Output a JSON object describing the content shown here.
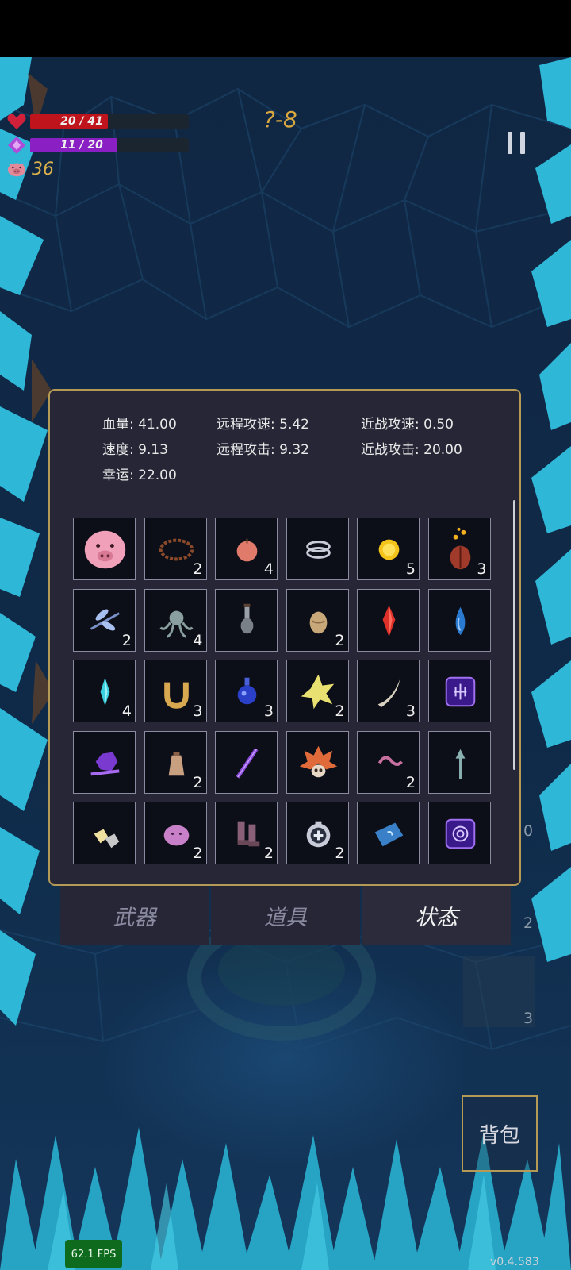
{
  "hud": {
    "hp_text": "20 / 41",
    "hp_fraction": 0.488,
    "mp_text": "11 / 20",
    "mp_fraction": 0.55,
    "coins": "36",
    "level": "?-8"
  },
  "stats": {
    "hp": "血量:  41.00",
    "ranged_speed": "远程攻速:  5.42",
    "melee_speed": "近战攻速:  0.50",
    "move_speed": "速度:  9.13",
    "ranged_attack": "远程攻击:  9.32",
    "melee_attack": "近战攻击:  20.00",
    "luck": "幸运:  22.00"
  },
  "items": [
    {
      "icon": "pig-mask-icon",
      "count": ""
    },
    {
      "icon": "thorn-wreath-icon",
      "count": "2"
    },
    {
      "icon": "apple-icon",
      "count": "4"
    },
    {
      "icon": "rings-icon",
      "count": ""
    },
    {
      "icon": "gold-coin-icon",
      "count": "5"
    },
    {
      "icon": "flaming-beetle-icon",
      "count": "3"
    },
    {
      "icon": "dragonfly-icon",
      "count": "2"
    },
    {
      "icon": "octopus-icon",
      "count": "4"
    },
    {
      "icon": "vial-icon",
      "count": ""
    },
    {
      "icon": "egg-icon",
      "count": "2"
    },
    {
      "icon": "red-crystal-icon",
      "count": ""
    },
    {
      "icon": "water-drop-icon",
      "count": ""
    },
    {
      "icon": "cyan-crystal-icon",
      "count": "4"
    },
    {
      "icon": "horseshoe-icon",
      "count": "3"
    },
    {
      "icon": "blue-potion-icon",
      "count": "3"
    },
    {
      "icon": "spiky-star-icon",
      "count": "2"
    },
    {
      "icon": "horn-icon",
      "count": "3"
    },
    {
      "icon": "purple-rune-icon",
      "count": ""
    },
    {
      "icon": "purple-snail-icon",
      "count": ""
    },
    {
      "icon": "sack-icon",
      "count": "2"
    },
    {
      "icon": "purple-wand-icon",
      "count": ""
    },
    {
      "icon": "spiky-skull-icon",
      "count": ""
    },
    {
      "icon": "pink-worm-icon",
      "count": "2"
    },
    {
      "icon": "arrow-totem-icon",
      "count": ""
    },
    {
      "icon": "gold-rocks-icon",
      "count": ""
    },
    {
      "icon": "pink-slime-icon",
      "count": "2"
    },
    {
      "icon": "boots-icon",
      "count": "2"
    },
    {
      "icon": "shield-ring-icon",
      "count": "2"
    },
    {
      "icon": "spell-book-icon",
      "count": ""
    },
    {
      "icon": "spiral-rune-icon",
      "count": ""
    }
  ],
  "tabs": {
    "weapons": "武器",
    "items": "道具",
    "status": "状态"
  },
  "bag_label": "背包",
  "side_counts": [
    "0",
    "2",
    "3"
  ],
  "fps": "62.1 FPS",
  "version": "v0.4.583",
  "colors": {
    "panel": "#262636",
    "panel_border": "#b59a56",
    "hp_bar": "#c0141c",
    "mp_bar": "#8a1fc4",
    "coin_text": "#d9b04a"
  }
}
